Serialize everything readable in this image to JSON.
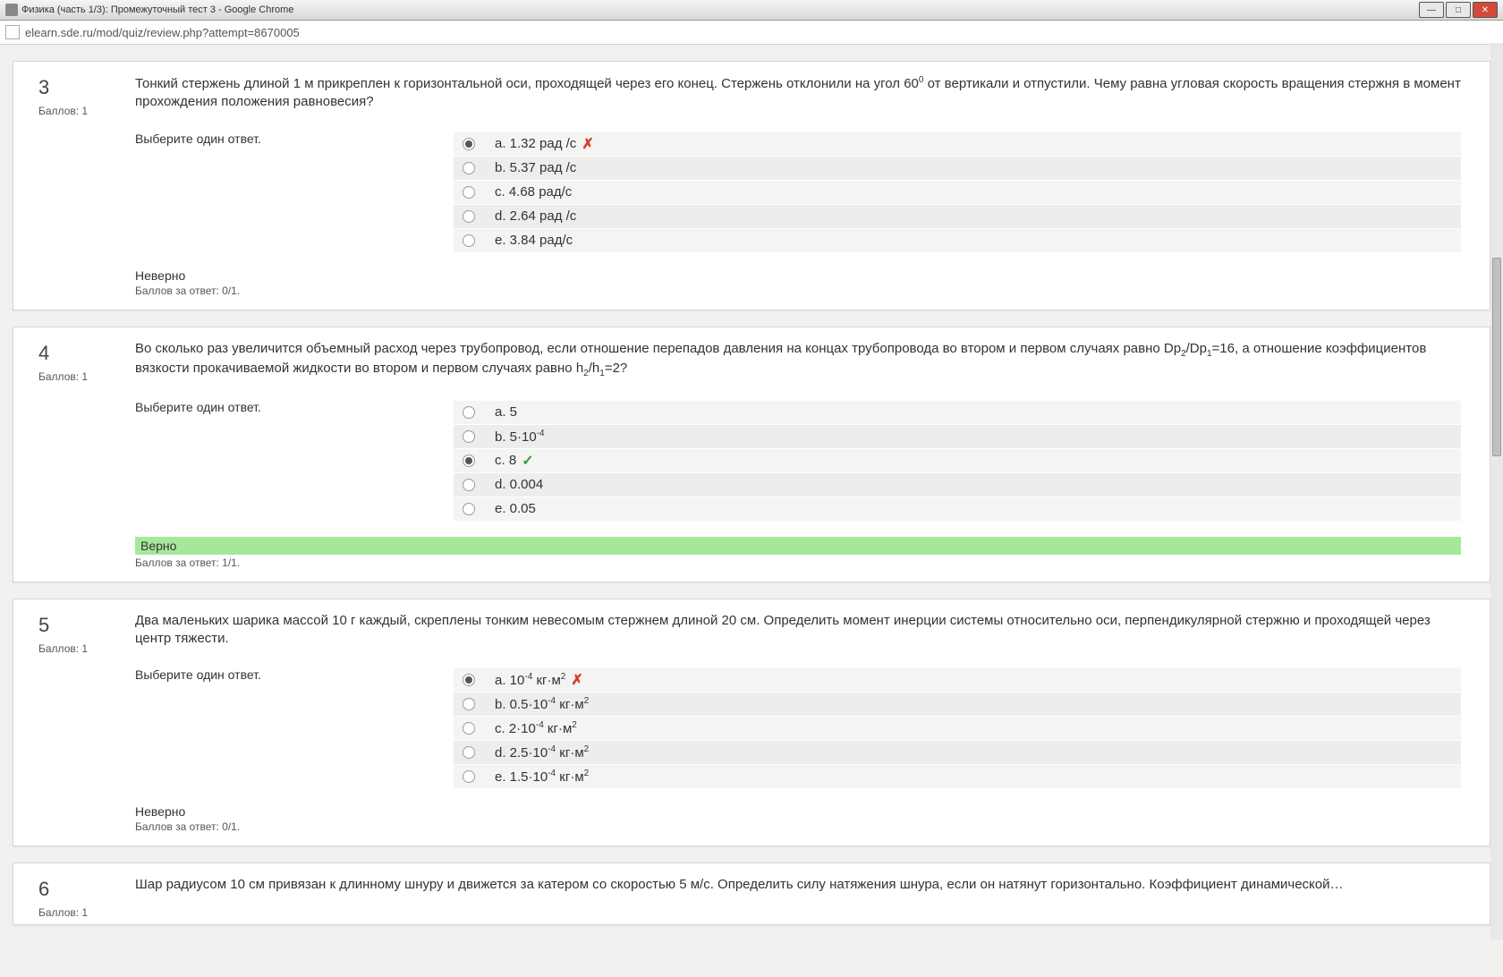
{
  "window": {
    "title": "Физика (часть 1/3): Промежуточный тест 3 - Google Chrome",
    "url": "elearn.sde.ru/mod/quiz/review.php?attempt=8670005"
  },
  "labels": {
    "points_prefix": "Баллов: ",
    "choose_one": "Выберите один ответ.",
    "score_prefix": "Баллов за ответ: ",
    "wrong": "Неверно",
    "right": "Верно"
  },
  "questions": [
    {
      "num": "3",
      "points": "1",
      "text_html": "Тонкий стержень длиной 1 м прикреплен к горизонтальной оси, проходящей через его конец. Стержень отклонили на угол 60<sup>0</sup> от вертикали и отпустили. Чему равна угловая скорость вращения стержня в момент прохождения положения равновесия?",
      "options": [
        {
          "k": "a.",
          "html": "1.32 рад /с",
          "sel": true,
          "mark": "wrong"
        },
        {
          "k": "b.",
          "html": "5.37 рад /с"
        },
        {
          "k": "c.",
          "html": "4.68 рад/с"
        },
        {
          "k": "d.",
          "html": "2.64 рад /с"
        },
        {
          "k": "e.",
          "html": "3.84 рад/с"
        }
      ],
      "result": "wrong",
      "score": "0/1."
    },
    {
      "num": "4",
      "points": "1",
      "text_html": "Во сколько раз увеличится объемный расход через трубопровод, если отношение перепадов давления на концах трубопровода во втором и первом случаях равно Dp<sub>2</sub>/Dp<sub>1</sub>=16, а отношение коэффициентов вязкости прокачиваемой жидкости во втором и первом случаях равно h<sub>2</sub>/h<sub>1</sub>=2?",
      "options": [
        {
          "k": "a.",
          "html": "5"
        },
        {
          "k": "b.",
          "html": "5·10<sup>-4</sup>"
        },
        {
          "k": "c.",
          "html": "8",
          "sel": true,
          "mark": "right"
        },
        {
          "k": "d.",
          "html": "0.004"
        },
        {
          "k": "e.",
          "html": "0.05"
        }
      ],
      "result": "right",
      "score": "1/1."
    },
    {
      "num": "5",
      "points": "1",
      "text_html": "Два маленьких шарика массой 10 г каждый, скреплены тонким невесомым стержнем длиной 20 см. Определить момент инерции системы относительно оси, перпендикулярной стержню и проходящей через центр тяжести.",
      "options": [
        {
          "k": "a.",
          "html": "10<sup>-4</sup> кг·м<sup>2</sup>",
          "sel": true,
          "mark": "wrong"
        },
        {
          "k": "b.",
          "html": "0.5·10<sup>-4</sup> кг·м<sup>2</sup>"
        },
        {
          "k": "c.",
          "html": "2·10<sup>-4</sup> кг·м<sup>2</sup>"
        },
        {
          "k": "d.",
          "html": "2.5·10<sup>-4</sup> кг·м<sup>2</sup>"
        },
        {
          "k": "e.",
          "html": "1.5·10<sup>-4</sup> кг·м<sup>2</sup>"
        }
      ],
      "result": "wrong",
      "score": "0/1."
    },
    {
      "num": "6",
      "points": "1",
      "text_html": "Шар радиусом 10 см привязан к длинному шнуру и движется за катером со скоростью 5 м/с. Определить силу натяжения шнура, если он натянут горизонтально. Коэффициент динамической…",
      "options": [],
      "result": null,
      "score": null,
      "partial": true
    }
  ]
}
